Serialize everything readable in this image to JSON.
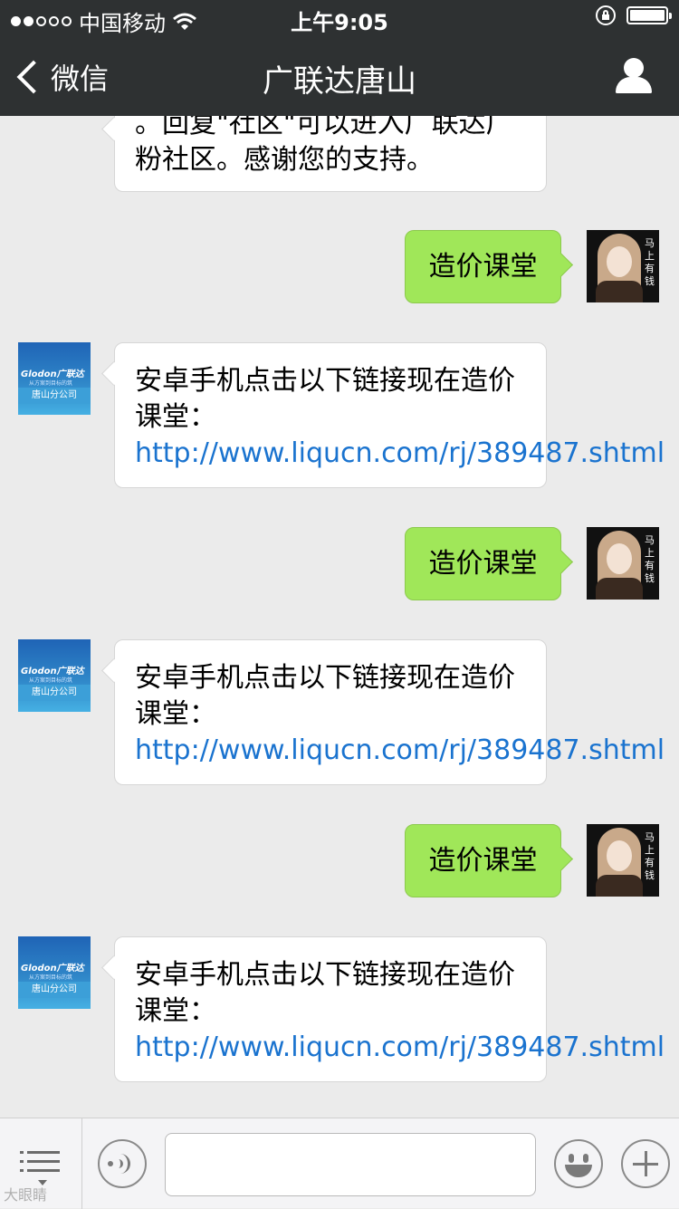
{
  "status_bar": {
    "carrier": "中国移动",
    "time": "上午9:05",
    "signal_filled": 2,
    "signal_total": 5,
    "battery_level": 1.0
  },
  "nav": {
    "back_label": "微信",
    "title": "广联达唐山",
    "profile_icon": "person-icon"
  },
  "messages": {
    "top_partial": "。回复\"社区\"可以进入广联达广粉社区。感谢您的支持。",
    "m1_out": "造价课堂",
    "m2_in_text": "安卓手机点击以下链接现在造价课堂：",
    "m2_in_link": "http://www.liqucn.com/rj/389487.shtml",
    "m3_out": "造价课堂",
    "m4_in_text": "安卓手机点击以下链接现在造价课堂：",
    "m4_in_link": "http://www.liqucn.com/rj/389487.shtml",
    "m5_out": "造价课堂",
    "m6_in_text": "安卓手机点击以下链接现在造价课堂：",
    "m6_in_link": "http://www.liqucn.com/rj/389487.shtml"
  },
  "avatars": {
    "brand_name": "Glodon广联达",
    "brand_tagline": "从方案到目标的筑",
    "brand_branch": "唐山分公司",
    "user_glyphs": "马上有钱"
  },
  "input_bar": {
    "placeholder": "",
    "icons": [
      "menu-icon",
      "voice-icon",
      "emoji-icon",
      "plus-icon"
    ]
  },
  "watermark": "大眼睛",
  "colors": {
    "nav_bg": "#2e3132",
    "chat_bg": "#ebebeb",
    "out_bubble": "#a0e759",
    "link": "#1a73cf"
  }
}
